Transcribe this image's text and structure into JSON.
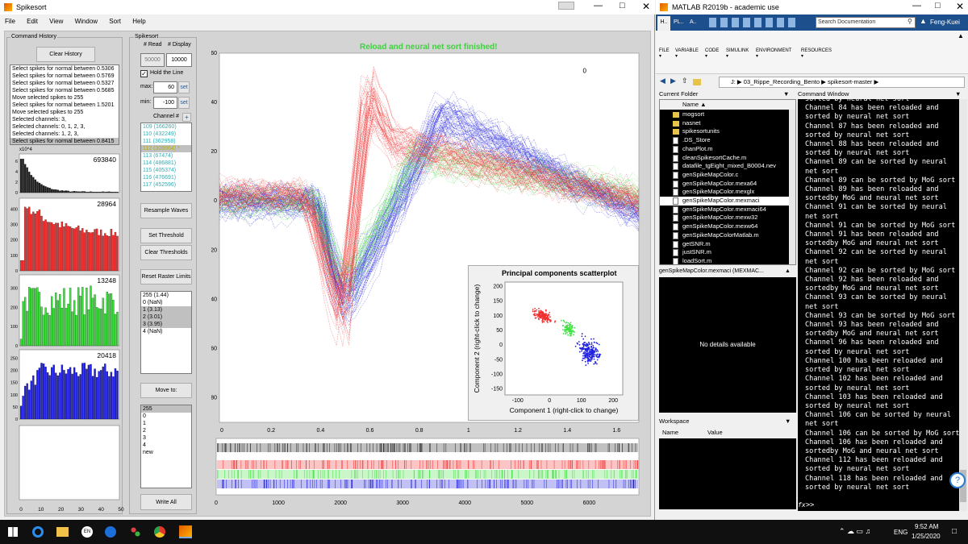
{
  "spikesort": {
    "window_title": "Spikesort",
    "menu": [
      "File",
      "Edit",
      "View",
      "Window",
      "Sort",
      "Help"
    ],
    "command_history_label": "Command History",
    "clear_history": "Clear History",
    "history": [
      "Select spikes for normal between 0.5306",
      "Select spikes for normal between 0.5769",
      "Select spikes for normal between 0.5327",
      "Select spikes for normal between 0.5685",
      "Move selected spikes to 255",
      "Select spikes for normal between 1.5201",
      "Move selected spikes to 255",
      "Selected channels: 3,",
      "Selected channels: 0, 1, 2, 3,",
      "Selected channels: 1, 2, 3,",
      "Select spikes for normal between 0.8415"
    ],
    "hist_exponent": "x10^4",
    "hist_counts": [
      "693840",
      "28964",
      "13248",
      "20418"
    ],
    "hist_axis_ticks": [
      "0",
      "10",
      "20",
      "30",
      "40",
      "50"
    ],
    "hist_y_ticks": [
      [
        "0",
        "2",
        "4",
        "6"
      ],
      [
        "0",
        "100",
        "200",
        "300",
        "400"
      ],
      [
        "0",
        "100",
        "200",
        "300"
      ],
      [
        "0",
        "50",
        "100",
        "150",
        "200",
        "250"
      ]
    ],
    "panel_label": "Spikesort",
    "read_label": "# Read",
    "display_label": "# Display",
    "read_value": "50000",
    "display_value": "10000",
    "hold_label": "Hold the Line",
    "max_label": "max:",
    "min_label": "min:",
    "max_value": "60",
    "min_value": "-100",
    "set_label": "set",
    "channel_label": "Channel #",
    "plus": "+",
    "channels": [
      "109 (166260)",
      "110 (432249)",
      "111 (362958)",
      "112 (308964) *",
      "113 (67474)",
      "114 (486881)",
      "115 (405374)",
      "116 (476691)",
      "117 (452596)"
    ],
    "resample": "Resample Waves",
    "set_threshold": "Set Threshold",
    "clear_thresholds": "Clear Thresholds",
    "reset_raster": "Reset Raster Limits",
    "clusters": [
      "255 (1.44)",
      "0 (NaN)",
      "1 (3.13)",
      "2 (3.01)",
      "3 (3.95)",
      "4 (NaN)"
    ],
    "move_to": "Move to:",
    "move_targets": [
      "255",
      "0",
      "1",
      "2",
      "3",
      "4",
      "new"
    ],
    "write_all": "Write All",
    "status": "Reload and neural net sort finished!",
    "wave_y_ticks": [
      "60",
      "40",
      "20",
      "0",
      "-20",
      "-40",
      "-60",
      "-80"
    ],
    "wave_x_ticks": [
      "0",
      "0.2",
      "0.4",
      "0.6",
      "0.8",
      "1",
      "1.2",
      "1.4",
      "1.6"
    ],
    "raster_x_ticks": [
      "0",
      "1000",
      "2000",
      "3000",
      "4000",
      "5000",
      "6000"
    ],
    "zero_marker": "0",
    "pca": {
      "title": "Principal components scatterplot",
      "xlabel": "Component 1 (right-click to change)",
      "ylabel": "Component 2 (right-click to change)",
      "x_ticks": [
        "-100",
        "0",
        "100",
        "200"
      ],
      "y_ticks": [
        "200",
        "150",
        "100",
        "50",
        "0",
        "-50",
        "-100",
        "-150"
      ]
    },
    "colors": {
      "red": "#f03030",
      "green": "#40e040",
      "blue": "#2020e0",
      "black": "#202020"
    }
  },
  "matlab": {
    "title": "MATLAB R2019b - academic use",
    "ribbon_tabs": [
      "H..",
      "PL..",
      "A.."
    ],
    "ribbon_groups": [
      "FILE",
      "VARIABLE",
      "CODE",
      "SIMULINK",
      "ENVIRONMENT",
      "RESOURCES"
    ],
    "search_placeholder": "Search Documentation",
    "user": "Feng-Kuei",
    "path": [
      "J:",
      "03_Rippe_Recording_Bento",
      "spikesort-master"
    ],
    "current_folder_label": "Current Folder",
    "name_col": "Name",
    "files": [
      "mogsort",
      "nasnet",
      "spikesortunits",
      ".DS_Store",
      "chanPlot.m",
      "cleanSpikesortCache.m",
      "datafile_tgEight_mixed_B0004.nev",
      "genSpikeMapColor.c",
      "genSpikeMapColor.mexa64",
      "genSpikeMapColor.mexglx",
      "genSpikeMapColor.mexmaci",
      "genSpikeMapColor.mexmaci64",
      "genSpikeMapColor.mexw32",
      "genSpikeMapColor.mexw64",
      "genSpikeMapColorMatlab.m",
      "getSNR.m",
      "justSNR.m",
      "loadSort.m"
    ],
    "details_title": "genSpikeMapColor.mexmaci  (MEXMAC...",
    "no_details": "No details available",
    "workspace_label": "Workspace",
    "ws_name": "Name",
    "ws_value": "Value",
    "command_window_label": "Command Window",
    "cmd_lines": [
      "sorted by neural net sort",
      "Channel 84 has been reloaded and",
      "sorted by neural net sort",
      "Channel 87 has been reloaded and",
      "sorted by neural net sort",
      "Channel 88 has been reloaded and",
      "sorted by neural net sort",
      "Channel 89 can be sorted by neural",
      "net sort",
      "Channel 89 can be sorted by MoG sort",
      "Channel 89 has been reloaded and",
      "sortedby MoG and neural net sort",
      "Channel 91 can be sorted by neural",
      "net sort",
      "Channel 91 can be sorted by MoG sort",
      "Channel 91 has been reloaded and",
      "sortedby MoG and neural net sort",
      "Channel 92 can be sorted by neural",
      "net sort",
      "Channel 92 can be sorted by MoG sort",
      "Channel 92 has been reloaded and",
      "sortedby MoG and neural net sort",
      "Channel 93 can be sorted by neural",
      "net sort",
      "Channel 93 can be sorted by MoG sort",
      "Channel 93 has been reloaded and",
      "sortedby MoG and neural net sort",
      "Channel 96 has been reloaded and",
      "sorted by neural net sort",
      "Channel 100 has been reloaded and",
      "sorted by neural net sort",
      "Channel 102 has been reloaded and",
      "sorted by neural net sort",
      "Channel 103 has been reloaded and",
      "sorted by neural net sort",
      "Channel 106 can be sorted by neural",
      "net sort",
      "Channel 106 can be sorted by MoG sort",
      "Channel 106 has been reloaded and",
      "sortedby MoG and neural net sort",
      "Channel 112 has been reloaded and",
      "sorted by neural net sort",
      "Channel 118 has been reloaded and",
      "sorted by neural net sort"
    ],
    "prompt": ">>",
    "fx": "fx"
  },
  "taskbar": {
    "time": "9:52 AM",
    "date": "1/25/2020",
    "lang": "ENG",
    "en_badge": "EN"
  }
}
